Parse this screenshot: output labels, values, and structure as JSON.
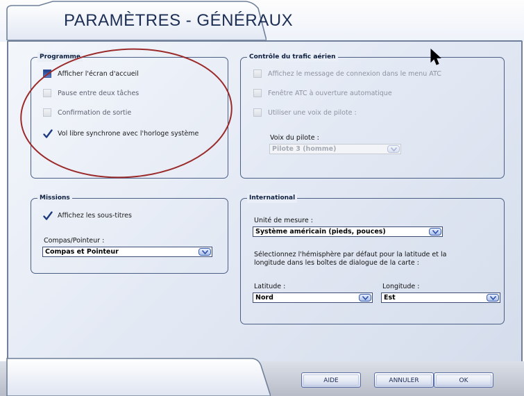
{
  "window": {
    "title": "PARAMÈTRES - GÉNÉRAUX"
  },
  "groups": {
    "programme": {
      "title": "Programme",
      "options": [
        {
          "label": "Afficher l'écran d'accueil",
          "checked": true,
          "style": "filled"
        },
        {
          "label": "Pause entre deux tâches",
          "checked": false
        },
        {
          "label": "Confirmation de sortie",
          "checked": false
        },
        {
          "label": "Vol libre synchrone avec l'horloge système",
          "checked": true,
          "style": "checkmark"
        }
      ]
    },
    "atc": {
      "title": "Contrôle du trafic aérien",
      "options": [
        {
          "label": "Affichez le message de connexion dans le menu ATC",
          "checked": false,
          "disabled": true
        },
        {
          "label": "Fenêtre ATC à ouverture automatique",
          "checked": false,
          "disabled": true
        },
        {
          "label": "Utiliser une voix de pilote :",
          "checked": false,
          "disabled": true
        }
      ],
      "voice_label": "Voix du pilote :",
      "voice_value": "Pilote 3 (homme)"
    },
    "missions": {
      "title": "Missions",
      "subtitles_label": "Affichez les sous-titres",
      "subtitles_checked": true,
      "compass_label": "Compas/Pointeur :",
      "compass_value": "Compas et Pointeur"
    },
    "international": {
      "title": "International",
      "unit_label": "Unité de mesure :",
      "unit_value": "Système américain (pieds, pouces)",
      "hemisphere_text_1": "Sélectionnez l'hémisphère par défaut pour la latitude et la",
      "hemisphere_text_2": "longitude dans les boîtes de dialogue de la carte :",
      "latitude_label": "Latitude :",
      "latitude_value": "Nord",
      "longitude_label": "Longitude :",
      "longitude_value": "Est"
    }
  },
  "footer": {
    "help_label": "AIDE",
    "cancel_label": "ANNULER",
    "ok_label": "OK"
  },
  "colors": {
    "frame_border": "#6f7f9a",
    "title_text": "#1d2e55",
    "annotation_circle": "#9b2a2a"
  }
}
